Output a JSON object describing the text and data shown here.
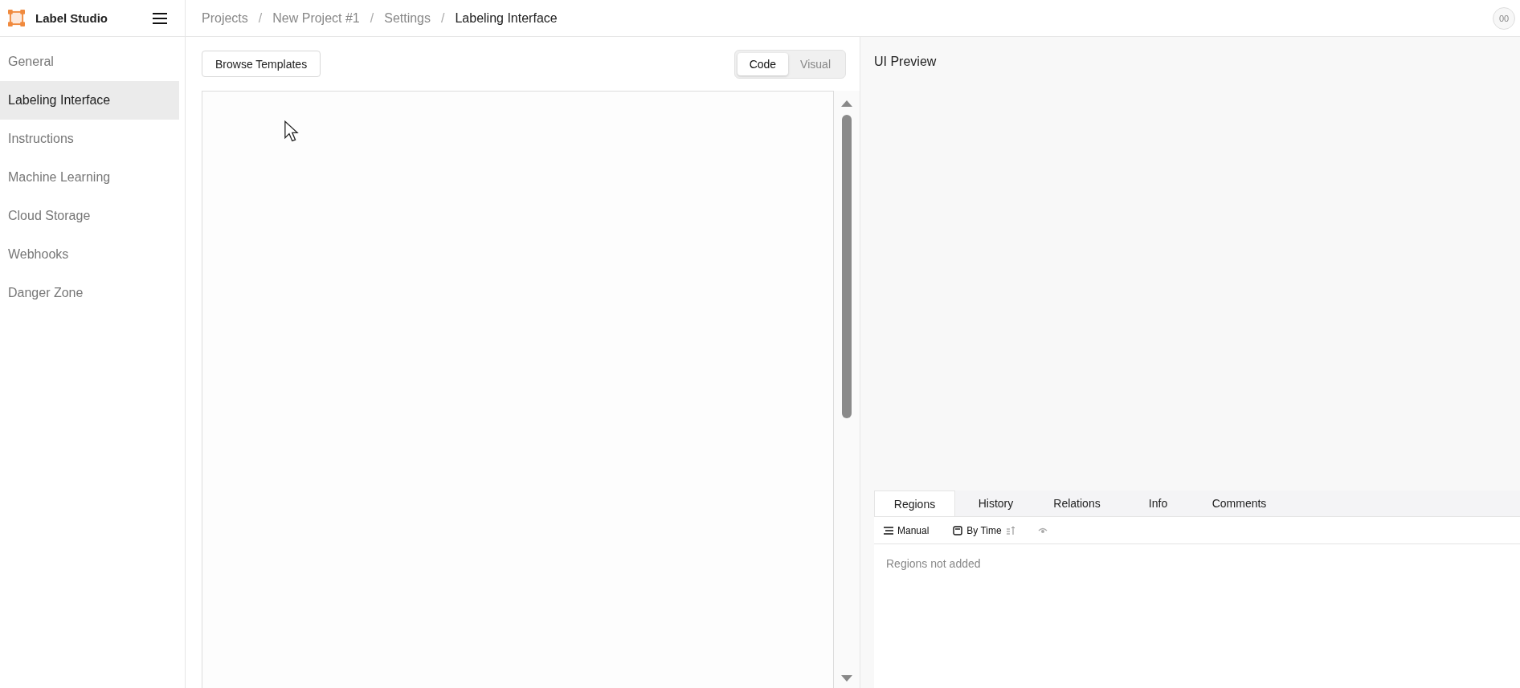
{
  "app": {
    "name": "Label Studio"
  },
  "breadcrumbs": [
    {
      "label": "Projects",
      "current": false
    },
    {
      "label": "New Project #1",
      "current": false
    },
    {
      "label": "Settings",
      "current": false
    },
    {
      "label": "Labeling Interface",
      "current": true
    }
  ],
  "separator": "/",
  "user": {
    "initials": "00"
  },
  "sidebar": {
    "items": [
      {
        "label": "General",
        "selected": false
      },
      {
        "label": "Labeling Interface",
        "selected": true
      },
      {
        "label": "Instructions",
        "selected": false
      },
      {
        "label": "Machine Learning",
        "selected": false
      },
      {
        "label": "Cloud Storage",
        "selected": false
      },
      {
        "label": "Webhooks",
        "selected": false
      },
      {
        "label": "Danger Zone",
        "selected": false
      }
    ]
  },
  "editor": {
    "browse_button": "Browse Templates",
    "modes": [
      {
        "label": "Code",
        "selected": true
      },
      {
        "label": "Visual",
        "selected": false
      }
    ]
  },
  "preview": {
    "title": "UI Preview",
    "tabs": [
      {
        "label": "Regions",
        "selected": true
      },
      {
        "label": "History",
        "selected": false
      },
      {
        "label": "Relations",
        "selected": false
      },
      {
        "label": "Info",
        "selected": false
      },
      {
        "label": "Comments",
        "selected": false
      }
    ],
    "tools": [
      {
        "kind": "grouping",
        "label": "Manual"
      },
      {
        "kind": "ordering",
        "label": "By Time"
      },
      {
        "kind": "visibility"
      }
    ],
    "empty_text": "Regions not added"
  }
}
